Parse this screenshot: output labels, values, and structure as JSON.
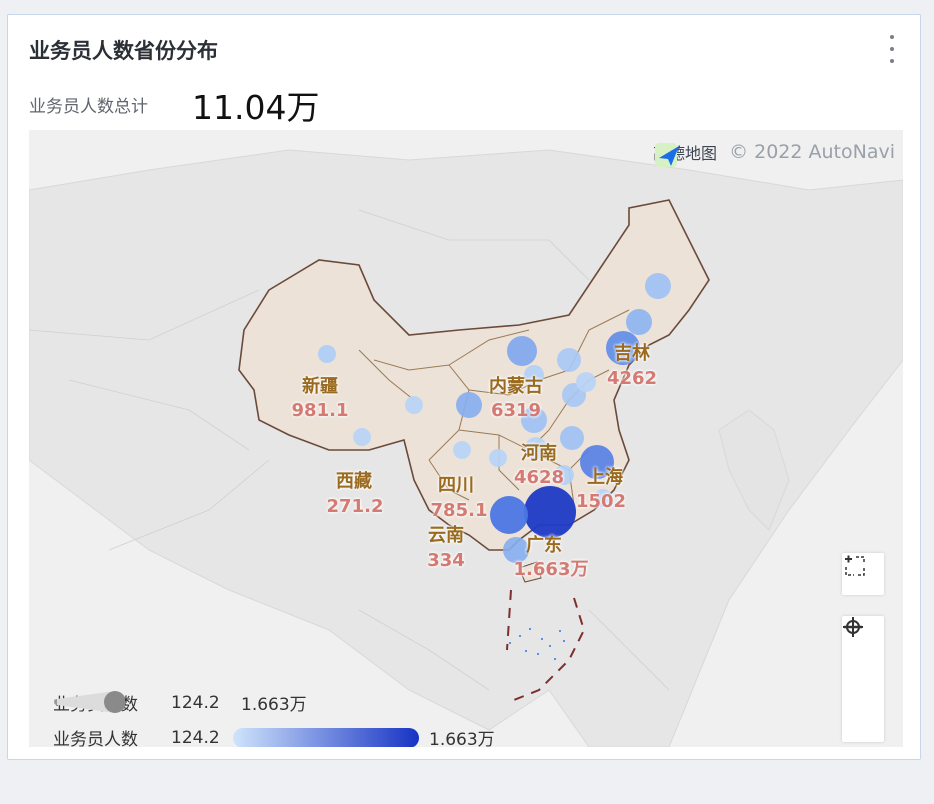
{
  "card": {
    "title": "业务员人数省份分布",
    "kpi_label": "业务员人数总计",
    "kpi_value": "11.04万"
  },
  "map": {
    "brand_name": "高德地图",
    "copyright": "© 2022 AutoNavi",
    "highlight_fill": "#ece2d8",
    "border_color": "#6b4a3a",
    "bubble_color": "#3d6ee0",
    "labels": [
      {
        "name": "新疆",
        "value": "981.1"
      },
      {
        "name": "西藏",
        "value": "271.2"
      },
      {
        "name": "内蒙古",
        "value": "6319"
      },
      {
        "name": "吉林",
        "value": "4262"
      },
      {
        "name": "河南",
        "value": "4628"
      },
      {
        "name": "上海",
        "value": "1502"
      },
      {
        "name": "四川",
        "value": "785.1"
      },
      {
        "name": "云南",
        "value": "334"
      },
      {
        "name": "广东",
        "value": "1.663万"
      }
    ]
  },
  "legend": {
    "size": {
      "name": "业务员人数",
      "min": "124.2",
      "max": "1.663万"
    },
    "color": {
      "name": "业务员人数",
      "min": "124.2",
      "max": "1.663万",
      "from": "#cfe4fb",
      "to": "#1733c4"
    }
  },
  "controls": {
    "fullscreen_icon": "fullscreen-icon",
    "zoom_in_icon": "plus-icon",
    "locate_icon": "locate-icon",
    "zoom_out_icon": "minus-icon"
  }
}
